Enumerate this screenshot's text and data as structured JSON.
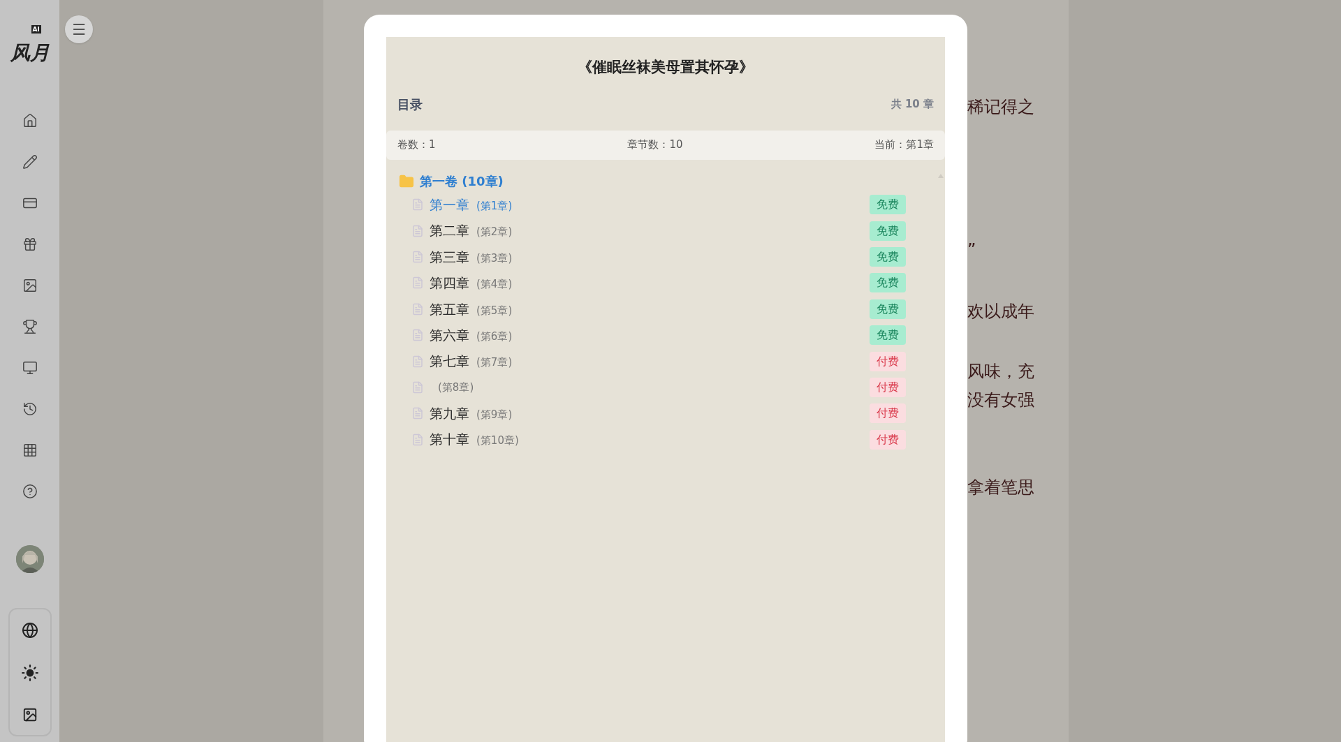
{
  "sidebar": {
    "logo": "风月",
    "logo_badge": "AI",
    "menu_button": "☰"
  },
  "background_text": {
    "fragments": [
      "稀记得之",
      "”",
      "欢以成年",
      "风味，充",
      "没有女强",
      "拿着笔思"
    ]
  },
  "modal": {
    "title": "《催眠丝袜美母置其怀孕》",
    "heading": "目录",
    "total": "共 10 章",
    "stats": [
      "卷数：1",
      "章节数：10",
      "当前：第1章"
    ],
    "volumes": [
      {
        "title": "第一卷 (10章)",
        "chapters": [
          {
            "title": "第一章",
            "number": "(第1章)",
            "badge": "免费",
            "kind": "free",
            "selected": true
          },
          {
            "title": "第二章",
            "number": "(第2章)",
            "badge": "免费",
            "kind": "free",
            "selected": false
          },
          {
            "title": "第三章",
            "number": "(第3章)",
            "badge": "免费",
            "kind": "free",
            "selected": false
          },
          {
            "title": "第四章",
            "number": "(第4章)",
            "badge": "免费",
            "kind": "free",
            "selected": false
          },
          {
            "title": "第五章",
            "number": "(第5章)",
            "badge": "免费",
            "kind": "free",
            "selected": false
          },
          {
            "title": "第六章",
            "number": "(第6章)",
            "badge": "免费",
            "kind": "free",
            "selected": false
          },
          {
            "title": "第七章",
            "number": "(第7章)",
            "badge": "付费",
            "kind": "paid",
            "selected": false
          },
          {
            "number": "(第8章)",
            "badge": "付费",
            "kind": "paid",
            "selected": false
          },
          {
            "title": "第九章",
            "number": "(第9章)",
            "badge": "付费",
            "kind": "paid",
            "selected": false
          },
          {
            "title": "第十章",
            "number": "(第10章)",
            "badge": "付费",
            "kind": "paid",
            "selected": false
          }
        ]
      }
    ]
  }
}
